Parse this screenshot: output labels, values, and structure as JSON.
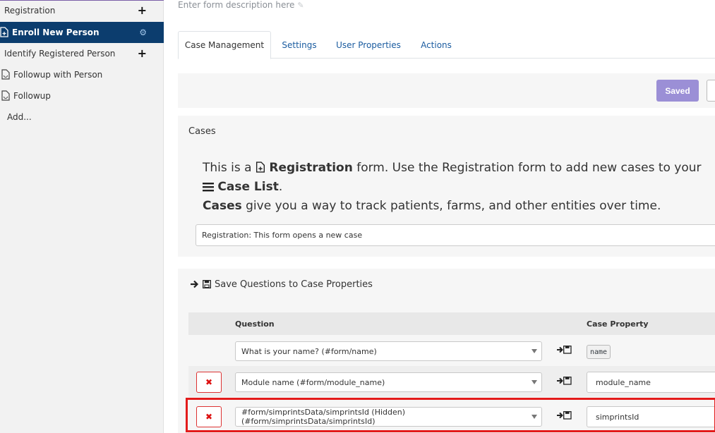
{
  "sidebar": {
    "items": [
      {
        "label": "Registration"
      },
      {
        "label": "Enroll New Person"
      },
      {
        "label": "Identify Registered Person"
      },
      {
        "label": "Followup with Person"
      },
      {
        "label": "Followup"
      },
      {
        "label": "Add..."
      }
    ]
  },
  "form": {
    "description_placeholder": "Enter form description here"
  },
  "tabs": [
    {
      "label": "Case Management"
    },
    {
      "label": "Settings"
    },
    {
      "label": "User Properties"
    },
    {
      "label": "Actions"
    }
  ],
  "toolbar": {
    "saved_label": "Saved"
  },
  "cases": {
    "header": "Cases",
    "intro": {
      "p1": "This is a",
      "registration": "Registration",
      "p2": "form. Use the Registration form to add new cases to your",
      "case_list": "Case List",
      "p3": ".",
      "cases_word": "Cases",
      "p4": "give you a way to track patients, farms, and other entities over time."
    },
    "form_type_value": "Registration: This form opens a new case"
  },
  "properties": {
    "header": "Save Questions to Case Properties",
    "col_question": "Question",
    "col_property": "Case Property",
    "rows": [
      {
        "question": "What is your name? (#form/name)",
        "property": "name"
      },
      {
        "question": "Module name (#form/module_name)",
        "property": "module_name"
      },
      {
        "question": "#form/simprintsData/simprintsId (Hidden) (#form/simprintsData/simprintsId)",
        "property": "simprintsId"
      }
    ],
    "delete_glyph": "✖"
  },
  "colors": {
    "sidebar_active": "#0c3d6e",
    "link": "#1b5ca0",
    "saved_button": "#9b8fd6",
    "highlight": "#e31b1b"
  },
  "icons": [
    "plus-icon",
    "gear-icon",
    "file-plus-icon",
    "file-icon",
    "pencil-icon",
    "arrow-right-icon",
    "floppy-disk-icon",
    "list-icon",
    "caret-down-icon"
  ]
}
